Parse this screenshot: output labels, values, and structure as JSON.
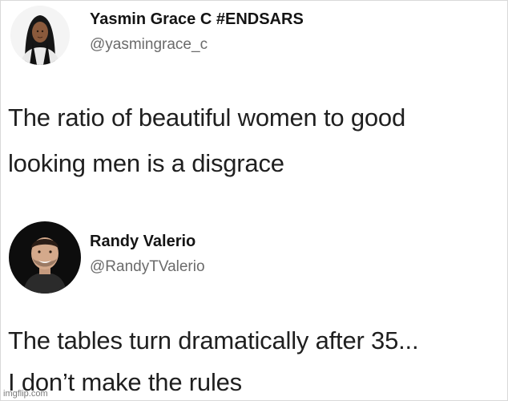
{
  "tweets": [
    {
      "display_name": "Yasmin Grace C #ENDSARS",
      "handle": "@yasmingrace_c",
      "text_lines": [
        "The ratio of beautiful women to good",
        "looking men is a disgrace"
      ]
    },
    {
      "display_name": "Randy Valerio",
      "handle": "@RandyTValerio",
      "text_lines": [
        "The tables turn dramatically after 35...",
        "I don’t make the rules"
      ]
    }
  ],
  "watermark": "imgflip.com",
  "colors": {
    "background": "#ffffff",
    "name": "#141414",
    "handle": "#6b6b6b",
    "body_text": "#1f1f1f"
  }
}
